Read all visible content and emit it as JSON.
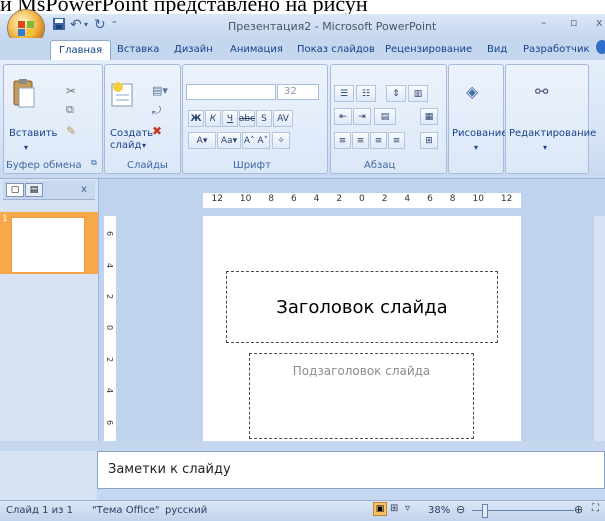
{
  "top_text": "и MsPowerPoint представлено на рисун",
  "window": {
    "title": "Презентация2 - Microsoft PowerPoint"
  },
  "tabs": [
    {
      "label": "Главная"
    },
    {
      "label": "Вставка"
    },
    {
      "label": "Дизайн"
    },
    {
      "label": "Анимация"
    },
    {
      "label": "Показ слайдов"
    },
    {
      "label": "Рецензирование"
    },
    {
      "label": "Вид"
    },
    {
      "label": "Разработчик"
    }
  ],
  "ribbon": {
    "clipboard": {
      "paste": "Вставить",
      "label": "Буфер обмена"
    },
    "slides": {
      "create_line1": "Создать",
      "create_line2": "слайд",
      "label": "Слайды"
    },
    "font": {
      "size": "32",
      "label": "Шрифт"
    },
    "paragraph": {
      "label": "Абзац"
    },
    "drawing": {
      "label": "Рисование"
    },
    "editing": {
      "label": "Редактирование"
    }
  },
  "ruler": {
    "ticks": [
      "12",
      "10",
      "8",
      "6",
      "4",
      "2",
      "0",
      "2",
      "4",
      "6",
      "8",
      "10",
      "12"
    ],
    "vticks": [
      "6",
      "4",
      "2",
      "0",
      "2",
      "4",
      "6"
    ]
  },
  "slides_pane": {
    "slide_number": "1"
  },
  "slide": {
    "title": "Заголовок слайда",
    "subtitle": "Подзаголовок слайда"
  },
  "notes": {
    "placeholder": "Заметки к слайду"
  },
  "status": {
    "slide": "Слайд 1 из 1",
    "theme": "\"Тема Office\"",
    "language": "русский",
    "zoom": "38%"
  },
  "colors": {
    "ribbon_bg": "#d6e3f5",
    "tab_text": "#15428b",
    "slide_thumb_border": "#f6a244"
  }
}
